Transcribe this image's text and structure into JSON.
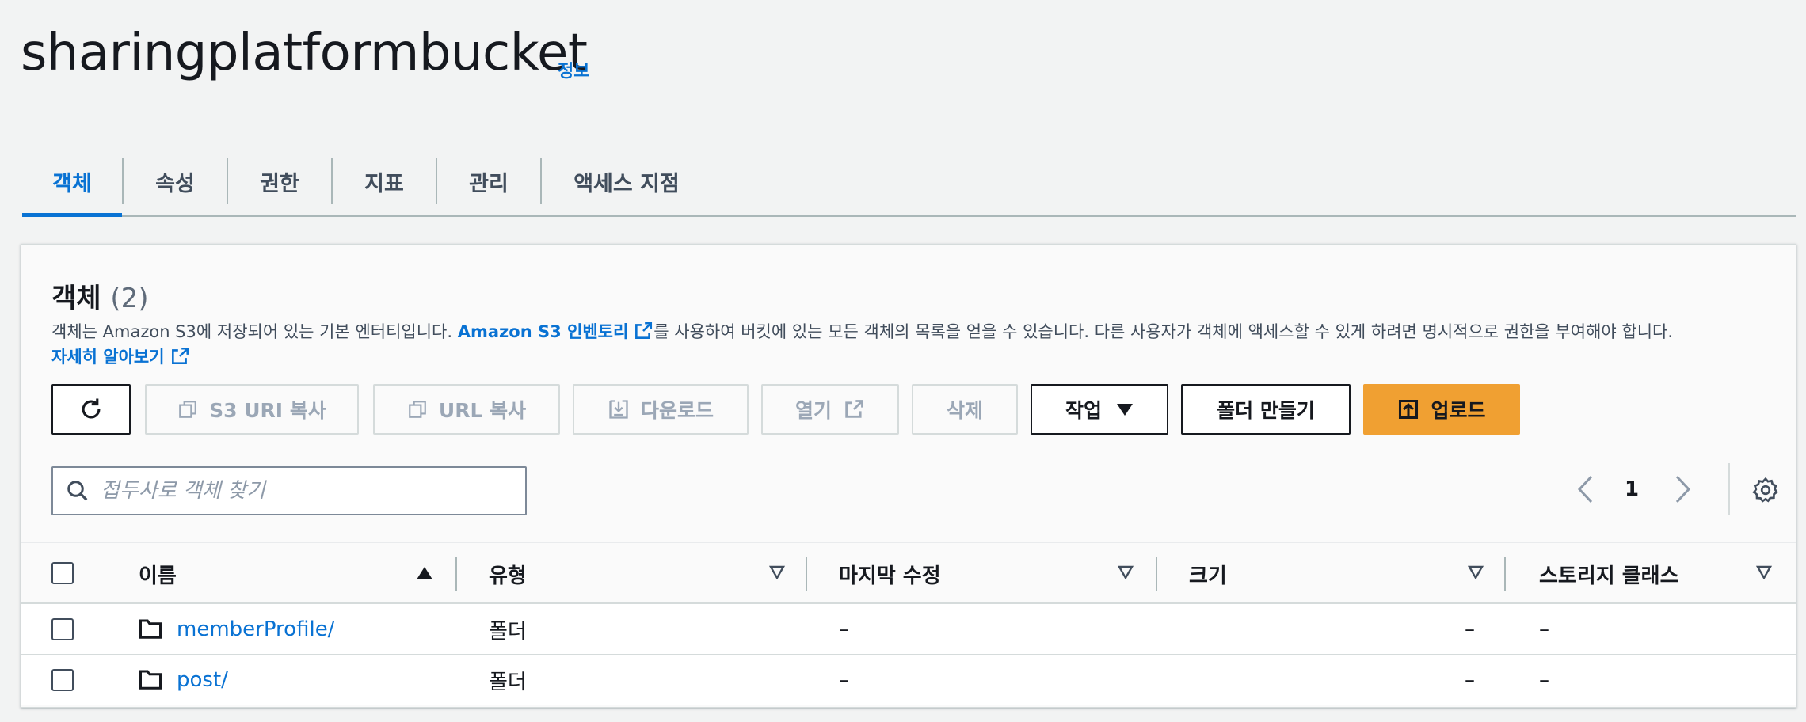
{
  "header": {
    "title": "sharingplatformbucket",
    "info_label": "정보"
  },
  "tabs": [
    {
      "label": "객체",
      "active": true
    },
    {
      "label": "속성"
    },
    {
      "label": "권한"
    },
    {
      "label": "지표"
    },
    {
      "label": "관리"
    },
    {
      "label": "액세스 지점"
    }
  ],
  "objects_panel": {
    "title": "객체",
    "count": "(2)",
    "desc_part1": "객체는 Amazon S3에 저장되어 있는 기본 엔터티입니다. ",
    "inventory_link": "Amazon S3 인벤토리",
    "desc_part2": "를 사용하여 버킷에 있는 모든 객체의 목록을 얻을 수 있습니다. 다른 사용자가 객체에 액세스할 수 있게 하려면 명시적으로 권한을 부여해야 합니다.",
    "learn_more": "자세히 알아보기"
  },
  "toolbar": {
    "copy_s3_uri": "S3 URI 복사",
    "copy_url": "URL 복사",
    "download": "다운로드",
    "open": "열기",
    "delete": "삭제",
    "actions": "작업",
    "create_folder": "폴더 만들기",
    "upload": "업로드"
  },
  "search": {
    "placeholder": "접두사로 객체 찾기",
    "value": ""
  },
  "pagination": {
    "current_page": "1"
  },
  "table": {
    "columns": [
      "이름",
      "유형",
      "마지막 수정",
      "크기",
      "스토리지 클래스"
    ],
    "rows": [
      {
        "name": "memberProfile/",
        "type": "폴더",
        "last_modified": "–",
        "size": "–",
        "storage_class": "–"
      },
      {
        "name": "post/",
        "type": "폴더",
        "last_modified": "–",
        "size": "–",
        "storage_class": "–"
      }
    ]
  },
  "colors": {
    "link": "#0972d3",
    "primary_button": "#f0a032",
    "text": "#16191f",
    "disabled": "#9ba7b6"
  }
}
